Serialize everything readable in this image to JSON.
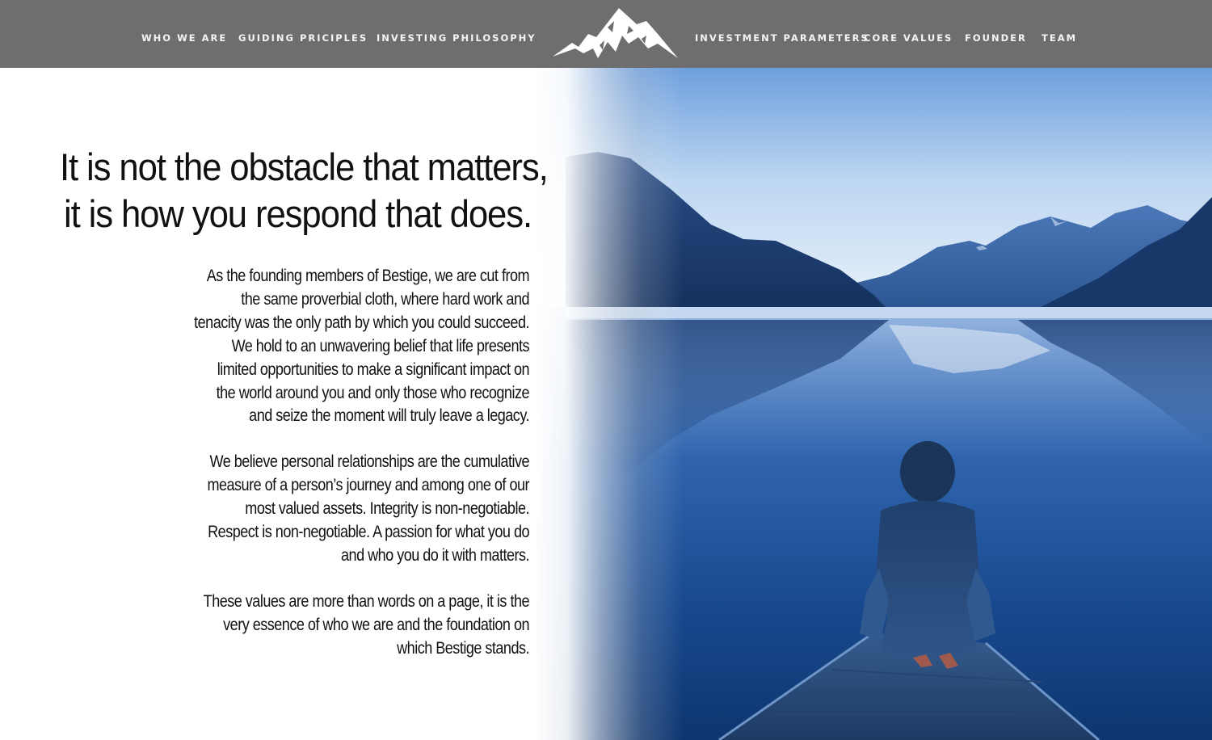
{
  "nav": {
    "left": [
      "WHO WE ARE",
      "GUIDING PRICIPLES",
      "INVESTING PHILOSOPHY"
    ],
    "right": [
      "INVESTMENT PARAMETERS",
      "CORE VALUES",
      "FOUNDER",
      "TEAM"
    ],
    "logo_icon": "mountain-peaks-logo"
  },
  "headline": {
    "lines": [
      "It is not the obstacle that matters,",
      "it is how you respond that does."
    ]
  },
  "paragraphs": [
    {
      "lines": [
        "As the founding members of Bestige, we are cut from",
        "the same proverbial cloth, where hard work and",
        "tenacity was the only path by which you could succeed.",
        "We hold to an unwavering belief that life presents",
        "limited opportunities to make a significant impact on",
        "the world around you and only those who recognize",
        "and seize the moment will truly leave a legacy."
      ]
    },
    {
      "lines": [
        "We believe personal relationships are the cumulative",
        "measure of a person’s journey and among one of our",
        "most valued assets.  Integrity is non-negotiable.",
        "Respect is non-negotiable.  A passion for what you do",
        "and who you do it with matters."
      ]
    },
    {
      "lines": [
        "These values are more than words on a page, it is the",
        "very essence of who we are and the foundation on",
        "which Bestige stands."
      ]
    }
  ],
  "colors": {
    "nav_background": "#6e6e6e",
    "nav_text": "#f4f4f4",
    "body_text": "#111111",
    "lake_blue": "#1e4f96"
  }
}
